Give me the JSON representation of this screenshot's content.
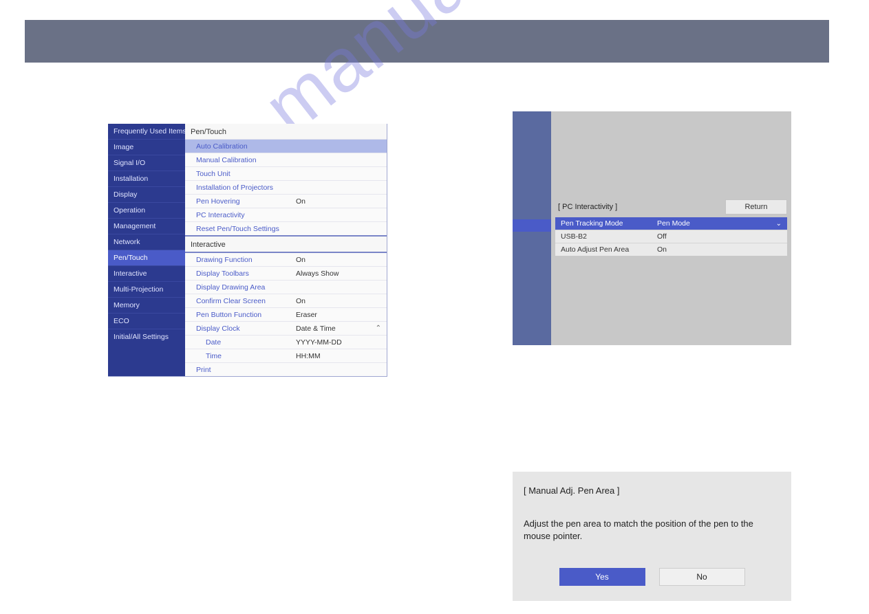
{
  "watermark": "manualshive.com",
  "settings": {
    "sidebar": [
      "Frequently Used Items",
      "Image",
      "Signal I/O",
      "Installation",
      "Display",
      "Operation",
      "Management",
      "Network",
      "Pen/Touch",
      "Interactive",
      "Multi-Projection",
      "Memory",
      "ECO",
      "Initial/All Settings"
    ],
    "sidebar_active_index": 8,
    "sections": [
      {
        "label": "Pen/Touch",
        "items": [
          {
            "label": "Auto Calibration",
            "value": "",
            "selected": true
          },
          {
            "label": "Manual Calibration",
            "value": ""
          },
          {
            "label": "Touch Unit",
            "value": ""
          },
          {
            "label": "Installation of Projectors",
            "value": ""
          },
          {
            "label": "Pen Hovering",
            "value": "On"
          },
          {
            "label": "PC Interactivity",
            "value": ""
          },
          {
            "label": "Reset Pen/Touch Settings",
            "value": ""
          }
        ]
      },
      {
        "label": "Interactive",
        "items": [
          {
            "label": "Drawing Function",
            "value": "On"
          },
          {
            "label": "Display Toolbars",
            "value": "Always Show"
          },
          {
            "label": "Display Drawing Area",
            "value": ""
          },
          {
            "label": "Confirm Clear Screen",
            "value": "On"
          },
          {
            "label": "Pen Button Function",
            "value": "Eraser"
          },
          {
            "label": "Display Clock",
            "value": "Date & Time",
            "expanded": true
          },
          {
            "label": "Date",
            "value": "YYYY-MM-DD",
            "sub": true
          },
          {
            "label": "Time",
            "value": "HH:MM",
            "sub": true
          },
          {
            "label": "Print",
            "value": ""
          }
        ]
      }
    ]
  },
  "pc_interactivity": {
    "title": "[ PC Interactivity ]",
    "return_label": "Return",
    "rows": [
      {
        "label": "Pen Tracking Mode",
        "value": "Pen Mode",
        "selected": true,
        "dropdown": true
      },
      {
        "label": "USB-B2",
        "value": "Off"
      },
      {
        "label": "Auto Adjust Pen Area",
        "value": "On"
      }
    ]
  },
  "dialog": {
    "title": "[ Manual Adj. Pen Area ]",
    "message": "Adjust the pen area to match the position of the pen to the mouse pointer.",
    "yes": "Yes",
    "no": "No"
  }
}
